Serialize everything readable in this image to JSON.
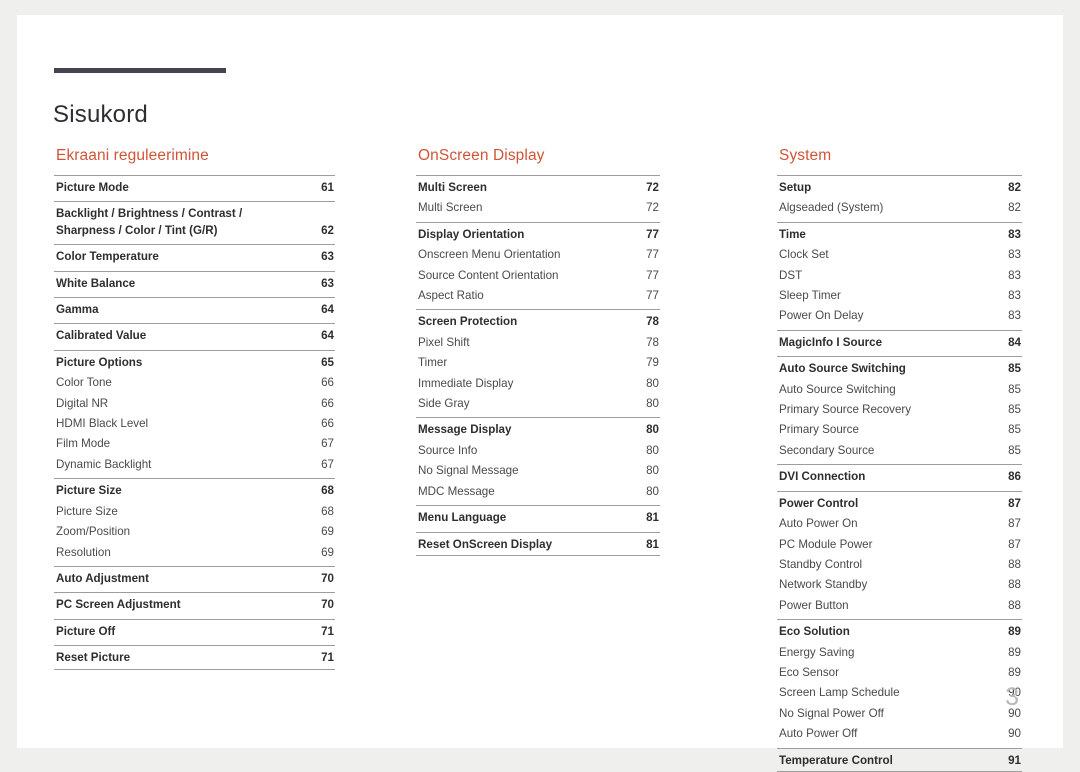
{
  "document": {
    "title": "Sisukord",
    "page_number": "3",
    "accent_color": "#cf5538",
    "rule_color": "#46424f",
    "page_bg": "#ffffff",
    "canvas_bg": "#efefee"
  },
  "columns": [
    {
      "section_title": "Ekraani reguleerimine",
      "groups": [
        {
          "entries": [
            {
              "label": "Picture Mode",
              "page": "61",
              "level": "main"
            }
          ]
        },
        {
          "entries": [
            {
              "label": "Backlight / Brightness / Contrast /\nSharpness / Color / Tint (G/R)",
              "page": "62",
              "level": "main",
              "two_line": true
            }
          ]
        },
        {
          "entries": [
            {
              "label": "Color Temperature",
              "page": "63",
              "level": "main"
            }
          ]
        },
        {
          "entries": [
            {
              "label": "White Balance",
              "page": "63",
              "level": "main"
            }
          ]
        },
        {
          "entries": [
            {
              "label": "Gamma",
              "page": "64",
              "level": "main"
            }
          ]
        },
        {
          "entries": [
            {
              "label": "Calibrated Value",
              "page": "64",
              "level": "main"
            }
          ]
        },
        {
          "entries": [
            {
              "label": "Picture Options",
              "page": "65",
              "level": "main"
            },
            {
              "label": "Color Tone",
              "page": "66",
              "level": "sub"
            },
            {
              "label": "Digital NR",
              "page": "66",
              "level": "sub"
            },
            {
              "label": "HDMI Black Level",
              "page": "66",
              "level": "sub"
            },
            {
              "label": "Film Mode",
              "page": "67",
              "level": "sub"
            },
            {
              "label": "Dynamic Backlight",
              "page": "67",
              "level": "sub"
            }
          ]
        },
        {
          "entries": [
            {
              "label": "Picture Size",
              "page": "68",
              "level": "main"
            },
            {
              "label": "Picture Size",
              "page": "68",
              "level": "sub"
            },
            {
              "label": "Zoom/Position",
              "page": "69",
              "level": "sub"
            },
            {
              "label": "Resolution",
              "page": "69",
              "level": "sub"
            }
          ]
        },
        {
          "entries": [
            {
              "label": "Auto Adjustment",
              "page": "70",
              "level": "main"
            }
          ]
        },
        {
          "entries": [
            {
              "label": "PC Screen Adjustment",
              "page": "70",
              "level": "main"
            }
          ]
        },
        {
          "entries": [
            {
              "label": "Picture Off",
              "page": "71",
              "level": "main"
            }
          ]
        },
        {
          "entries": [
            {
              "label": "Reset Picture",
              "page": "71",
              "level": "main"
            }
          ]
        }
      ]
    },
    {
      "section_title": "OnScreen Display",
      "groups": [
        {
          "entries": [
            {
              "label": "Multi Screen",
              "page": "72",
              "level": "main"
            },
            {
              "label": "Multi Screen",
              "page": "72",
              "level": "sub"
            }
          ]
        },
        {
          "entries": [
            {
              "label": "Display Orientation",
              "page": "77",
              "level": "main"
            },
            {
              "label": "Onscreen Menu Orientation",
              "page": "77",
              "level": "sub"
            },
            {
              "label": "Source Content Orientation",
              "page": "77",
              "level": "sub"
            },
            {
              "label": "Aspect Ratio",
              "page": "77",
              "level": "sub"
            }
          ]
        },
        {
          "entries": [
            {
              "label": "Screen Protection",
              "page": "78",
              "level": "main"
            },
            {
              "label": "Pixel Shift",
              "page": "78",
              "level": "sub"
            },
            {
              "label": "Timer",
              "page": "79",
              "level": "sub"
            },
            {
              "label": "Immediate Display",
              "page": "80",
              "level": "sub"
            },
            {
              "label": "Side Gray",
              "page": "80",
              "level": "sub"
            }
          ]
        },
        {
          "entries": [
            {
              "label": "Message Display",
              "page": "80",
              "level": "main"
            },
            {
              "label": "Source Info",
              "page": "80",
              "level": "sub"
            },
            {
              "label": "No Signal Message",
              "page": "80",
              "level": "sub"
            },
            {
              "label": "MDC Message",
              "page": "80",
              "level": "sub"
            }
          ]
        },
        {
          "entries": [
            {
              "label": "Menu Language",
              "page": "81",
              "level": "main"
            }
          ]
        },
        {
          "entries": [
            {
              "label": "Reset OnScreen Display",
              "page": "81",
              "level": "main"
            }
          ]
        }
      ]
    },
    {
      "section_title": "System",
      "groups": [
        {
          "entries": [
            {
              "label": "Setup",
              "page": "82",
              "level": "main"
            },
            {
              "label": "Algseaded (System)",
              "page": "82",
              "level": "sub"
            }
          ]
        },
        {
          "entries": [
            {
              "label": "Time",
              "page": "83",
              "level": "main"
            },
            {
              "label": "Clock Set",
              "page": "83",
              "level": "sub"
            },
            {
              "label": "DST",
              "page": "83",
              "level": "sub"
            },
            {
              "label": "Sleep Timer",
              "page": "83",
              "level": "sub"
            },
            {
              "label": "Power On Delay",
              "page": "83",
              "level": "sub"
            }
          ]
        },
        {
          "entries": [
            {
              "label": "MagicInfo I Source",
              "page": "84",
              "level": "main"
            }
          ]
        },
        {
          "entries": [
            {
              "label": "Auto Source Switching",
              "page": "85",
              "level": "main"
            },
            {
              "label": "Auto Source Switching",
              "page": "85",
              "level": "sub"
            },
            {
              "label": "Primary Source Recovery",
              "page": "85",
              "level": "sub"
            },
            {
              "label": "Primary Source",
              "page": "85",
              "level": "sub"
            },
            {
              "label": "Secondary Source",
              "page": "85",
              "level": "sub"
            }
          ]
        },
        {
          "entries": [
            {
              "label": "DVI Connection",
              "page": "86",
              "level": "main"
            }
          ]
        },
        {
          "entries": [
            {
              "label": "Power Control",
              "page": "87",
              "level": "main"
            },
            {
              "label": "Auto Power On",
              "page": "87",
              "level": "sub"
            },
            {
              "label": "PC Module Power",
              "page": "87",
              "level": "sub"
            },
            {
              "label": "Standby Control",
              "page": "88",
              "level": "sub"
            },
            {
              "label": "Network Standby",
              "page": "88",
              "level": "sub"
            },
            {
              "label": "Power Button",
              "page": "88",
              "level": "sub"
            }
          ]
        },
        {
          "entries": [
            {
              "label": "Eco Solution",
              "page": "89",
              "level": "main"
            },
            {
              "label": "Energy Saving",
              "page": "89",
              "level": "sub"
            },
            {
              "label": "Eco Sensor",
              "page": "89",
              "level": "sub"
            },
            {
              "label": "Screen Lamp Schedule",
              "page": "90",
              "level": "sub"
            },
            {
              "label": "No Signal Power Off",
              "page": "90",
              "level": "sub"
            },
            {
              "label": "Auto Power Off",
              "page": "90",
              "level": "sub"
            }
          ]
        },
        {
          "entries": [
            {
              "label": "Temperature Control",
              "page": "91",
              "level": "main"
            }
          ]
        }
      ]
    }
  ]
}
